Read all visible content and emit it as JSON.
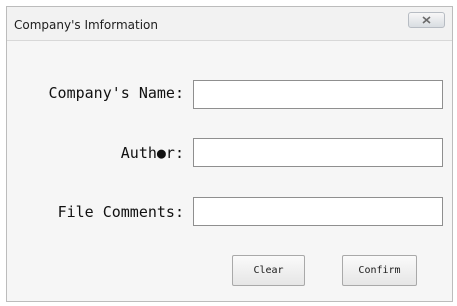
{
  "window": {
    "title": "Company's Imformation",
    "close_icon": "close-icon"
  },
  "form": {
    "fields": [
      {
        "label": "Company's Name:",
        "value": "",
        "placeholder": ""
      },
      {
        "label": "Auth●r:",
        "value": "",
        "placeholder": ""
      },
      {
        "label": "File Comments:",
        "value": "",
        "placeholder": ""
      }
    ]
  },
  "buttons": {
    "clear_label": "Clear",
    "confirm_label": "Confirm"
  },
  "colors": {
    "window_bg": "#f6f6f6",
    "input_border": "#8f8f8f",
    "text": "#111111"
  }
}
